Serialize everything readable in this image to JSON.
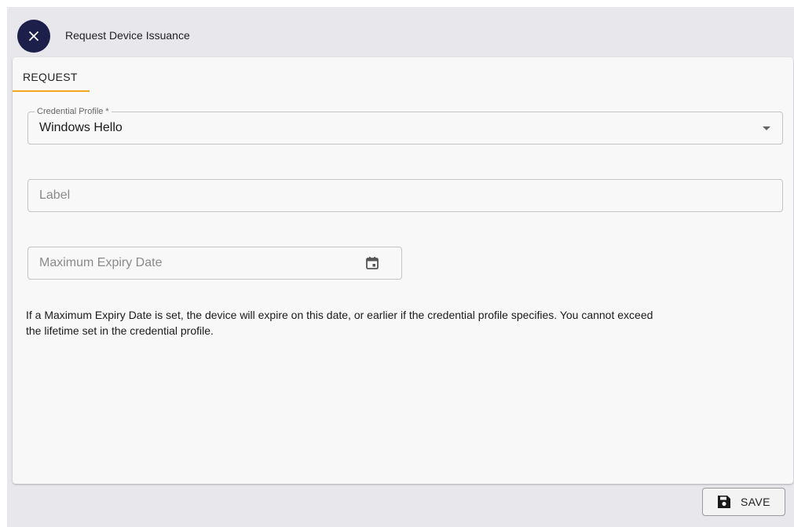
{
  "dialog": {
    "title": "Request Device Issuance"
  },
  "tabs": [
    {
      "label": "REQUEST",
      "active": true
    }
  ],
  "form": {
    "credential_profile": {
      "label": "Credential Profile *",
      "value": "Windows Hello"
    },
    "label_field": {
      "placeholder": "Label",
      "value": ""
    },
    "expiry_date": {
      "placeholder": "Maximum Expiry Date",
      "value": "",
      "icon": "calendar-icon"
    },
    "help_text": "If a Maximum Expiry Date is set, the device will expire on this date, or earlier if the credential profile specifies. You cannot exceed the lifetime set in the credential profile."
  },
  "actions": {
    "save_label": "SAVE",
    "save_icon": "floppy-disk-icon",
    "close_icon": "close-icon"
  },
  "colors": {
    "close_button_bg": "#1d1f4b",
    "tab_underline": "#f5a623",
    "background": "#e8e8ec",
    "card": "#f8f8f8"
  }
}
